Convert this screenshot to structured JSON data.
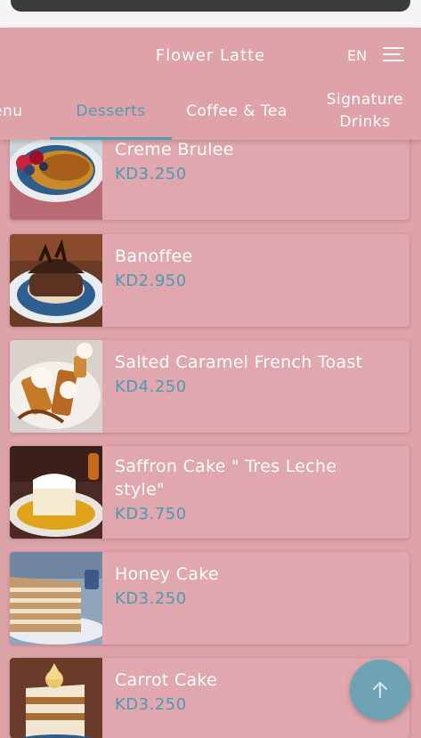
{
  "header": {
    "title": "Flower Latte",
    "lang": "EN"
  },
  "tabs": [
    {
      "label": "enu"
    },
    {
      "label": "Desserts"
    },
    {
      "label": "Coffee & Tea"
    },
    {
      "label": "Signature Drinks"
    }
  ],
  "items": [
    {
      "name": "Creme Brulee",
      "price": "KD3.250"
    },
    {
      "name": "Banoffee",
      "price": "KD2.950"
    },
    {
      "name": "Salted Caramel French Toast",
      "price": "KD4.250"
    },
    {
      "name": "Saffron Cake \" Tres Leche style\"",
      "price": "KD3.750"
    },
    {
      "name": "Honey Cake",
      "price": "KD3.250"
    },
    {
      "name": "Carrot Cake",
      "price": "KD3.250"
    }
  ],
  "colors": {
    "background": "#dea2a9",
    "accent": "#4d9bb6",
    "price": "#4b9ab3",
    "fab": "#6ea3b3"
  },
  "icons": {
    "menu": "hamburger-menu-icon",
    "scroll_top": "arrow-up-icon"
  }
}
